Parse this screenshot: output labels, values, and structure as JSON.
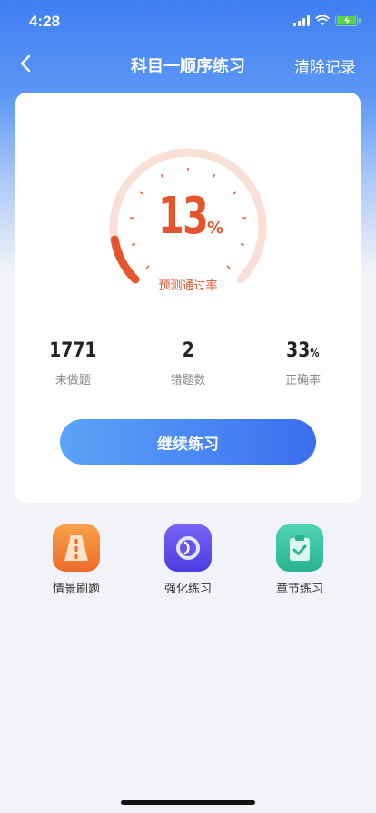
{
  "status_bar": {
    "time": "4:28"
  },
  "nav": {
    "title": "科目一顺序练习",
    "action": "清除记录"
  },
  "gauge": {
    "value": "13",
    "unit": "%",
    "label": "预测通过率",
    "progress": 0.13,
    "track_color": "#f9e0d6",
    "progress_color": "#e4552d"
  },
  "stats": [
    {
      "value": "1771",
      "unit": "",
      "label": "未做题"
    },
    {
      "value": "2",
      "unit": "",
      "label": "错题数"
    },
    {
      "value": "33",
      "unit": "%",
      "label": "正确率"
    }
  ],
  "continue_button": "继续练习",
  "quick_actions": [
    {
      "label": "情景刷题",
      "icon": "road-scene-icon"
    },
    {
      "label": "强化练习",
      "icon": "target-icon"
    },
    {
      "label": "章节练习",
      "icon": "clipboard-check-icon"
    }
  ]
}
